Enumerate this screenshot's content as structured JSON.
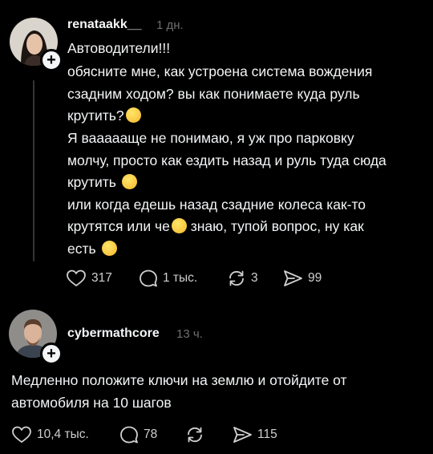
{
  "post": {
    "username": "renataakk__",
    "timestamp": "1 дн.",
    "lines": [
      "Автоводители!!!",
      "обясните мне, как устроена система вождения",
      "сзадним ходом? вы как понимаете куда руль",
      "крутить?",
      "Я ваааааще не понимаю, я уж про парковку",
      "молчу, просто как ездить назад и руль туда сюда",
      "крутить",
      "или когда едешь назад сзадние колеса как-то",
      "крутятся или че",
      " знаю, тупой вопрос, ну как",
      "есть"
    ],
    "emojis": [
      "rofl-emoji",
      "thinking-emoji",
      "grinning-sweat-emoji",
      "crying-emoji"
    ],
    "likes": "317",
    "replies": "1 тыс.",
    "reposts": "3",
    "shares": "99"
  },
  "reply": {
    "username": "cybermathcore",
    "timestamp": "13 ч.",
    "lines": [
      "Медленно положите ключи на землю и отойдите от",
      "автомобиля на 10 шагов"
    ],
    "likes": "10,4 тыс.",
    "replies": "78",
    "reposts": "",
    "shares": "115"
  },
  "icons": {
    "heart": "heart-icon",
    "comment": "comment-icon",
    "repost": "repost-icon",
    "share": "share-icon",
    "follow": "plus-icon"
  },
  "colors": {
    "background": "#000000",
    "text": "#f3f5f7",
    "muted": "#6f6f6f",
    "thread_line": "#333638"
  }
}
